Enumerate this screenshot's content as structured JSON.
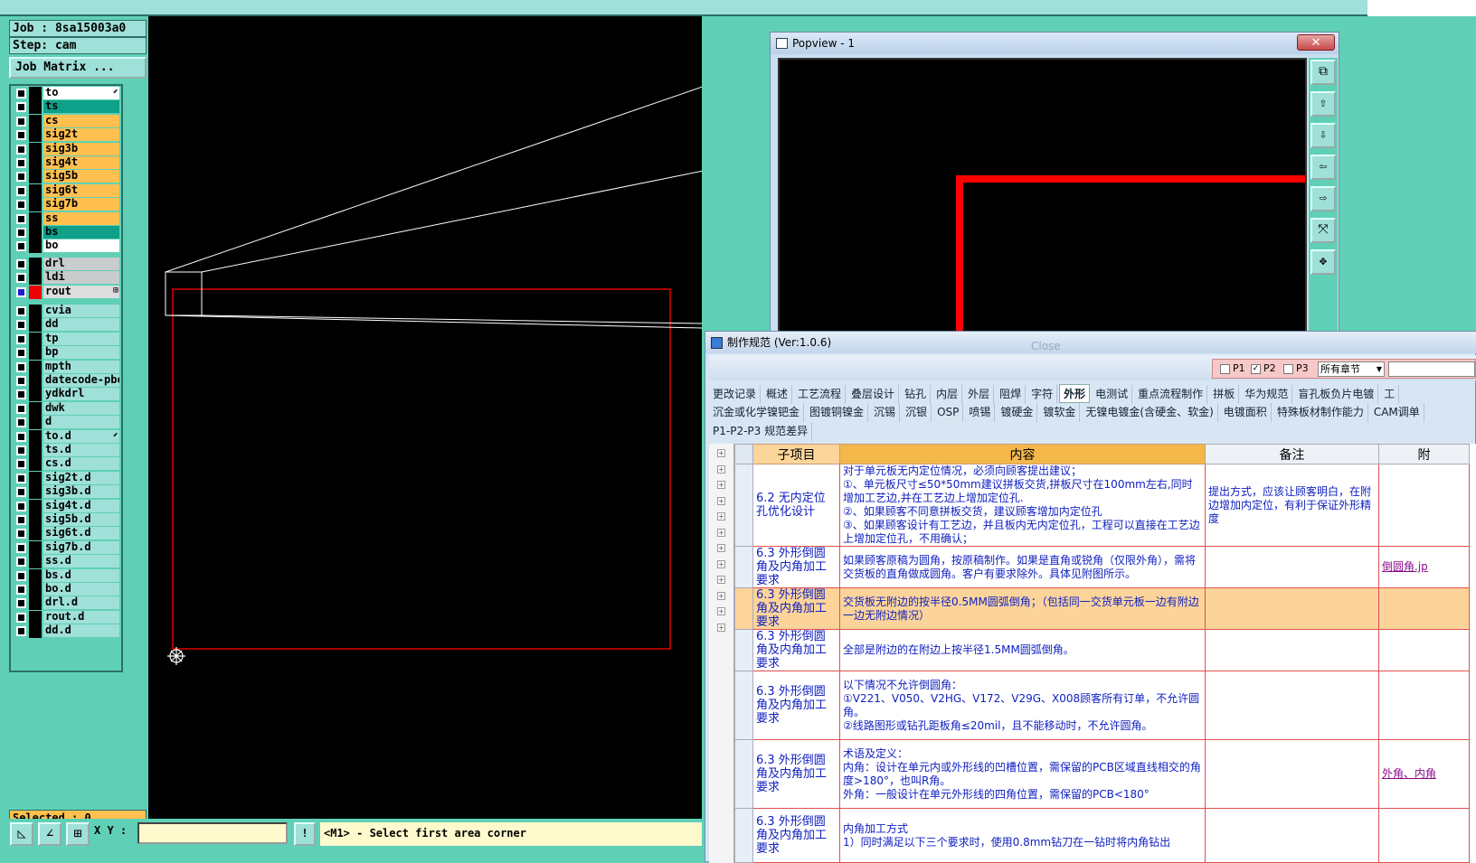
{
  "left_panel": {
    "job": "Job : 8sa15003a0",
    "step": "Step: cam",
    "job_matrix": "Job Matrix ...",
    "selected": "Selected : 0",
    "layers_group1": [
      {
        "name": "to",
        "color": "#ffffff",
        "marker": "⬋"
      },
      {
        "name": "ts",
        "color": "#0fa08a"
      },
      {
        "name": "cs",
        "color": "#ffc050"
      },
      {
        "name": "sig2t",
        "color": "#ffc050"
      },
      {
        "name": "sig3b",
        "color": "#ffc050"
      },
      {
        "name": "sig4t",
        "color": "#ffc050"
      },
      {
        "name": "sig5b",
        "color": "#ffc050"
      },
      {
        "name": "sig6t",
        "color": "#ffc050"
      },
      {
        "name": "sig7b",
        "color": "#ffc050"
      },
      {
        "name": "ss",
        "color": "#ffc050"
      },
      {
        "name": "bs",
        "color": "#0fa08a"
      },
      {
        "name": "bo",
        "color": "#ffffff"
      }
    ],
    "layers_group2": [
      {
        "name": "drl",
        "color": "#c8cccc"
      },
      {
        "name": "ldi",
        "color": "#c8cccc"
      },
      {
        "name": "rout",
        "color": "#dddddd",
        "active": true,
        "marker": "⊞"
      }
    ],
    "layers_group3": [
      {
        "name": "cvia"
      },
      {
        "name": "dd"
      },
      {
        "name": "tp"
      },
      {
        "name": "bp"
      },
      {
        "name": "mpth"
      },
      {
        "name": "datecode-pbe"
      },
      {
        "name": "ydkdrl"
      },
      {
        "name": "dwk"
      },
      {
        "name": "d"
      },
      {
        "name": "to.d",
        "marker": "⬋"
      },
      {
        "name": "ts.d"
      },
      {
        "name": "cs.d"
      },
      {
        "name": "sig2t.d"
      },
      {
        "name": "sig3b.d"
      },
      {
        "name": "sig4t.d"
      },
      {
        "name": "sig5b.d"
      },
      {
        "name": "sig6t.d"
      },
      {
        "name": "sig7b.d"
      },
      {
        "name": "ss.d"
      },
      {
        "name": "bs.d"
      },
      {
        "name": "bo.d"
      },
      {
        "name": "drl.d"
      },
      {
        "name": "rout.d"
      },
      {
        "name": "dd.d"
      }
    ]
  },
  "bottom_bar": {
    "xy_label": "X Y :",
    "xy_value": "",
    "status": "<M1> - Select first area corner",
    "bang": "!"
  },
  "popview": {
    "title": "Popview - 1",
    "close": "✕"
  },
  "spec_window": {
    "title": "制作规范 (Ver:1.0.6)",
    "shadow_text": "Close",
    "filters": [
      {
        "label": "P1",
        "checked": false
      },
      {
        "label": "P2",
        "checked": true
      },
      {
        "label": "P3",
        "checked": false
      }
    ],
    "chapter_select": "所有章节",
    "tabs_row1": [
      "更改记录",
      "概述",
      "工艺流程",
      "叠层设计",
      "钻孔",
      "内层",
      "外层",
      "阻焊",
      "字符",
      "外形",
      "电测试",
      "重点流程制作",
      "拼板",
      "华为规范",
      "盲孔板负片电镀",
      "工"
    ],
    "active_tab": "外形",
    "tabs_row2": [
      "沉金或化学镍钯金",
      "图镀铜镍金",
      "沉锡",
      "沉银",
      "OSP",
      "喷锡",
      "镀硬金",
      "镀软金",
      "无镍电镀金(含硬金、软金)",
      "电镀面积",
      "特殊板材制作能力",
      "CAM调单"
    ],
    "tabs_row3": [
      "P1-P2-P3 规范差异"
    ],
    "headers": [
      "子项目",
      "内容",
      "备注",
      "附"
    ],
    "rows": [
      {
        "sub": "6.2 无内定位孔优化设计",
        "content": "对于单元板无内定位情况，必须向顾客提出建议；\n①、单元板尺寸≤50*50mm建议拼板交货,拼板尺寸在100mm左右,同时增加工艺边,并在工艺边上增加定位孔.\n②、如果顾客不同意拼板交货，建议顾客增加内定位孔\n③、如果顾客设计有工艺边，并且板内无内定位孔，工程可以直接在工艺边上增加定位孔，不用确认；",
        "note": "提出方式，应该让顾客明白，在附边增加内定位，有利于保证外形精度",
        "attach": ""
      },
      {
        "sub": "6.3 外形倒圆角及内角加工要求",
        "content": "如果顾客原稿为圆角，按原稿制作。如果是直角或锐角（仅限外角），需将交货板的直角做成圆角。客户有要求除外。具体见附图所示。",
        "note": "",
        "attach": "倒圆角.jp"
      },
      {
        "sub": "6.3 外形倒圆角及内角加工要求",
        "content": "交货板无附边的按半径0.5MM圆弧倒角；（包括同一交货单元板一边有附边一边无附边情况）",
        "note": "",
        "attach": "",
        "highlight": true
      },
      {
        "sub": "6.3 外形倒圆角及内角加工要求",
        "content": "全部是附边的在附边上按半径1.5MM圆弧倒角。",
        "note": "",
        "attach": ""
      },
      {
        "sub": "6.3 外形倒圆角及内角加工要求",
        "content": "以下情况不允许倒圆角：\n①V221、V050、V2HG、V172、V29G、X008顾客所有订单，不允许圆角。\n②线路图形或钻孔距板角≤20mil，且不能移动时，不允许圆角。",
        "note": "",
        "attach": ""
      },
      {
        "sub": "6.3 外形倒圆角及内角加工要求",
        "content": "术语及定义：\n内角：设计在单元内或外形线的凹槽位置，需保留的PCB区域直线相交的角度>180°，也叫R角。\n外角：一般设计在单元外形线的四角位置，需保留的PCB<180°",
        "note": "",
        "attach": "外角、内角"
      },
      {
        "sub": "6.3 外形倒圆角及内角加工要求",
        "content": "内角加工方式\n1）同时满足以下三个要求时，使用0.8mm钻刀在一钻时将内角钻出",
        "note": "",
        "attach": ""
      }
    ]
  }
}
